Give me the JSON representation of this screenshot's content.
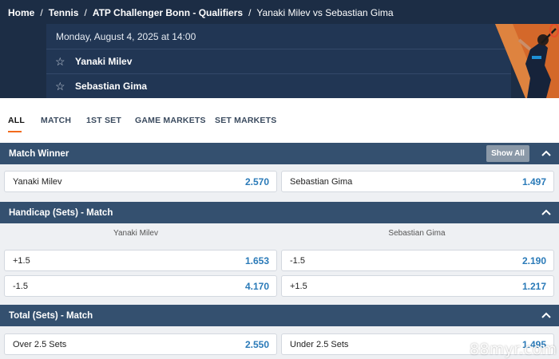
{
  "breadcrumb": {
    "items": [
      "Home",
      "Tennis",
      "ATP Challenger Bonn - Qualifiers",
      "Yanaki Milev vs Sebastian Gima"
    ],
    "separator": "/"
  },
  "event": {
    "datetime": "Monday, August 4, 2025 at 14:00",
    "players": [
      "Yanaki Milev",
      "Sebastian Gima"
    ]
  },
  "tabs": [
    "ALL",
    "MATCH",
    "1ST SET",
    "GAME MARKETS",
    "SET MARKETS"
  ],
  "active_tab": "ALL",
  "markets": {
    "match_winner": {
      "title": "Match Winner",
      "show_all_label": "Show All",
      "outcomes": [
        {
          "label": "Yanaki Milev",
          "odds": "2.570"
        },
        {
          "label": "Sebastian Gima",
          "odds": "1.497"
        }
      ]
    },
    "handicap": {
      "title": "Handicap (Sets) - Match",
      "columns": [
        "Yanaki Milev",
        "Sebastian Gima"
      ],
      "rows": [
        [
          {
            "label": "+1.5",
            "odds": "1.653"
          },
          {
            "label": "-1.5",
            "odds": "2.190"
          }
        ],
        [
          {
            "label": "-1.5",
            "odds": "4.170"
          },
          {
            "label": "+1.5",
            "odds": "1.217"
          }
        ]
      ]
    },
    "total_sets": {
      "title": "Total (Sets) - Match",
      "outcomes": [
        {
          "label": "Over 2.5 Sets",
          "odds": "2.550"
        },
        {
          "label": "Under 2.5 Sets",
          "odds": "1.495"
        }
      ]
    }
  },
  "watermark": "88myr.com",
  "colors": {
    "header_bg": "#1c2d45",
    "section_header_bg": "#34506f",
    "odds_blue": "#2a7ab8",
    "accent_orange": "#f26b1d",
    "show_all_bg": "#8b99a8"
  },
  "icons": [
    "star-icon",
    "chevron-up-icon",
    "tennis-player-image"
  ]
}
